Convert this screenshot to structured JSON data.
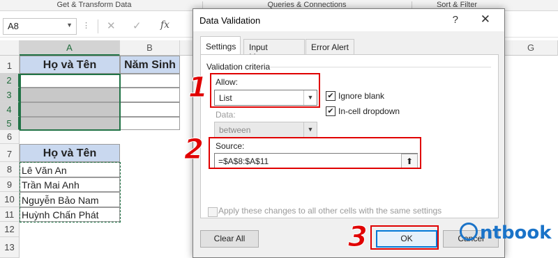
{
  "ribbon": {
    "groups": [
      "Get & Transform Data",
      "Queries & Connections",
      "Sort & Filter"
    ]
  },
  "formula_bar": {
    "name_box": "A8",
    "cancel_icon": "✕",
    "enter_icon": "✓",
    "fx_label": "fx"
  },
  "sheet": {
    "columns": [
      "A",
      "B",
      "G"
    ],
    "rows": [
      "1",
      "2",
      "3",
      "4",
      "5",
      "6",
      "7",
      "8",
      "9",
      "10",
      "11",
      "12",
      "13"
    ],
    "header_a1": "Họ và Tên",
    "header_b1": "Năm Sinh",
    "header_a7": "Họ và Tên",
    "names": [
      "Lê Văn An",
      "Trần Mai Anh",
      "Nguyễn Bảo Nam",
      "Huỳnh Chấn Phát"
    ]
  },
  "dialog": {
    "title": "Data Validation",
    "help": "?",
    "close": "✕",
    "tabs": [
      "Settings",
      "Input Message",
      "Error Alert"
    ],
    "group_title": "Validation criteria",
    "allow_label": "Allow:",
    "allow_value": "List",
    "ignore_blank": "Ignore blank",
    "in_cell_dropdown": "In-cell dropdown",
    "data_label": "Data:",
    "data_value": "between",
    "source_label": "Source:",
    "source_value": "=$A$8:$A$11",
    "apply_text": "Apply these changes to all other cells with the same settings",
    "clear_all": "Clear All",
    "ok": "OK",
    "cancel": "Cancel"
  },
  "annotations": {
    "step1": "1",
    "step2": "2",
    "step3": "3",
    "color": "#e00000"
  },
  "watermark": {
    "text": "ntbook"
  }
}
